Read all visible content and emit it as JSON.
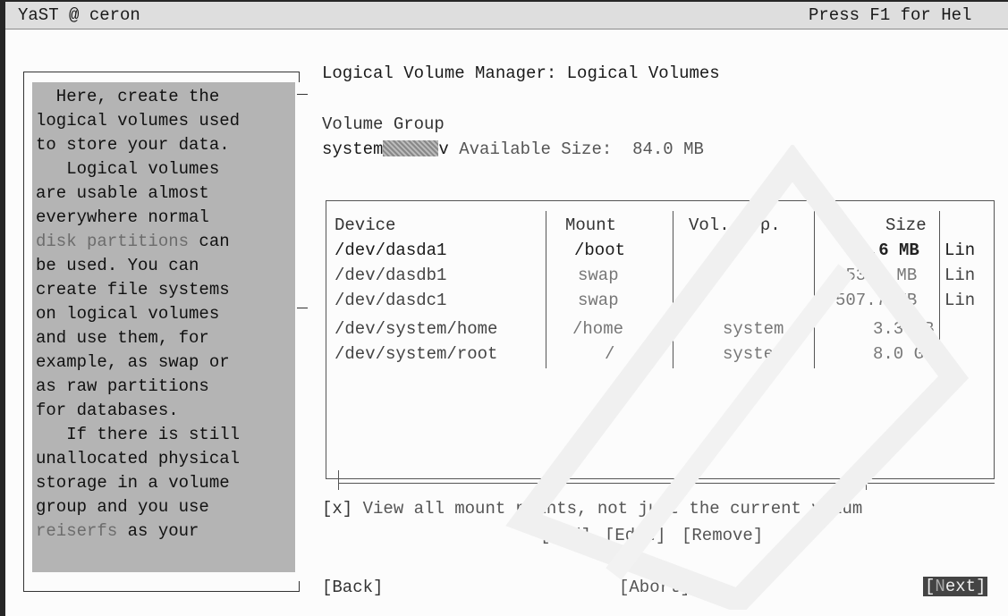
{
  "titlebar": {
    "left": "YaST @ ceron",
    "right": "Press F1 for Hel"
  },
  "header": {
    "title": "Logical Volume Manager: Logical Volumes"
  },
  "volume_group": {
    "label": "Volume Group",
    "selected": "system",
    "arrow": "v",
    "available_label": "Available Size:",
    "available_value": "84.0 MB"
  },
  "help": {
    "lines": [
      "  Here, create the",
      "logical volumes used",
      "to store your data.",
      "   Logical volumes",
      "are usable almost",
      "everywhere normal",
      "disk partitions can",
      "be used. You can",
      "create file systems",
      "on logical volumes",
      "and use them, for",
      "example, as swap or",
      "as raw partitions",
      "for databases.",
      "   If there is still",
      "unallocated physical",
      "storage in a volume",
      "group and you use",
      "reiserfs as your"
    ],
    "highlight": {
      "line6": "disk partitions",
      "line6_rest": " can",
      "line18": "reiserfs",
      "line18_rest": " as your"
    }
  },
  "table": {
    "headers": {
      "device": "Device",
      "mount": "Mount",
      "vg": "Vol. Grp.",
      "size": "Size"
    },
    "rows": [
      {
        "device": "/dev/dasda1",
        "mount": "/boot",
        "vg": "",
        "size": "64.6 MB",
        "type": "Lin"
      },
      {
        "device": "/dev/dasdb1",
        "mount": "swap",
        "vg": "",
        "size": "253.8 MB",
        "type": "Lin"
      },
      {
        "device": "/dev/dasdc1",
        "mount": "swap",
        "vg": "",
        "size": "507.7 MB",
        "type": "Lin"
      },
      {
        "device": "/dev/system/home",
        "mount": "/home",
        "vg": "system",
        "size": "3.3 GB",
        "type": ""
      },
      {
        "device": "/dev/system/root",
        "mount": "/",
        "vg": "system",
        "size": "8.0 GB",
        "type": ""
      }
    ]
  },
  "checkbox": {
    "mark": "[x]",
    "label": "View all mount points, not just the current volum"
  },
  "actions": {
    "add": "[Add]",
    "edit": "[Edit]",
    "remove": "[Remove]"
  },
  "footer": {
    "back": "[Back]",
    "abort": "[Abort]",
    "next_open": "[",
    "next_hot": "N",
    "next_rest": "ext]"
  }
}
